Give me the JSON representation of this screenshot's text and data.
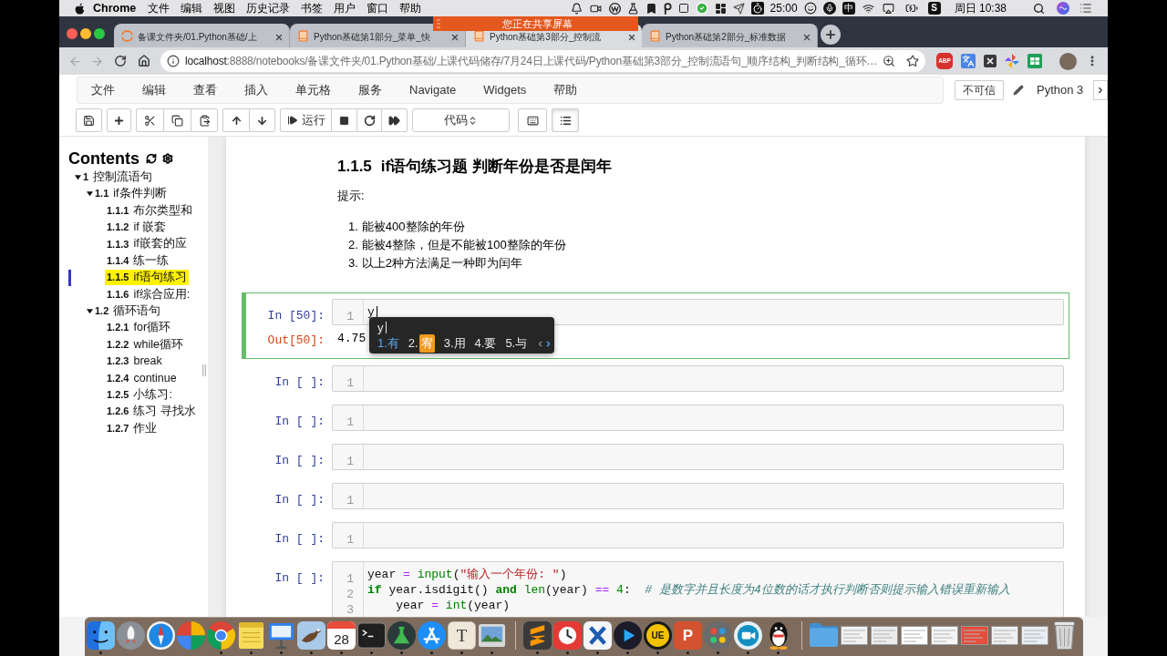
{
  "menu_bar": {
    "app": "Chrome",
    "items": [
      "文件",
      "编辑",
      "视图",
      "历史记录",
      "书签",
      "用户",
      "窗口",
      "帮助"
    ]
  },
  "status": {
    "timer": "25:00",
    "input_source": "中",
    "badge": "S",
    "clock": "周日 10:38"
  },
  "share_banner": "您正在共享屏幕",
  "tabs": [
    {
      "title": "备课文件夹/01.Python基础/上",
      "favicon": {
        "kind": "ring"
      },
      "selected": false
    },
    {
      "title": "Python基础第1部分_菜单_快",
      "favicon": {
        "kind": "book"
      },
      "selected": false
    },
    {
      "title": "Python基础第3部分_控制流",
      "favicon": {
        "kind": "book"
      },
      "selected": true
    },
    {
      "title": "Python基础第2部分_标准数据",
      "favicon": {
        "kind": "book"
      },
      "selected": false
    }
  ],
  "navigation": {
    "back_enabled": false,
    "forward_enabled": false
  },
  "address": {
    "host": "localhost",
    "path": ":8888/notebooks/备课文件夹/01.Python基础/上课代码储存/7月24日上课代码/Python基础第3部分_控制流语句_顺序结构_判断结构_循环…"
  },
  "extensions": [
    {
      "kind": "abp",
      "label": "ABP"
    },
    {
      "kind": "translate"
    },
    {
      "kind": "x"
    },
    {
      "kind": "pinwheel"
    },
    {
      "kind": "sheet"
    },
    {
      "kind": "avatar"
    }
  ],
  "notebook_menu": [
    "文件",
    "编辑",
    "查看",
    "插入",
    "单元格",
    "服务",
    "Navigate",
    "Widgets",
    "帮助"
  ],
  "trust": "不可信",
  "kernel": "Python 3",
  "toolbar": {
    "run": "运行",
    "cell_type": "代码",
    "toc_pressed": true
  },
  "toc": {
    "title": "Contents",
    "items": [
      {
        "number": "1",
        "label": "控制流语句",
        "expanded": true,
        "selected": false,
        "children": [
          {
            "number": "1.1",
            "label": "if条件判断",
            "expanded": true,
            "selected": false,
            "children": [
              {
                "number": "1.1.1",
                "label": "布尔类型和",
                "selected": false
              },
              {
                "number": "1.1.2",
                "label": "if 嵌套",
                "selected": false
              },
              {
                "number": "1.1.3",
                "label": "if嵌套的应",
                "selected": false
              },
              {
                "number": "1.1.4",
                "label": "练一练",
                "selected": false
              },
              {
                "number": "1.1.5",
                "label": "if语句练习",
                "selected": true
              },
              {
                "number": "1.1.6",
                "label": "if综合应用:",
                "selected": false
              }
            ]
          },
          {
            "number": "1.2",
            "label": "循环语句",
            "expanded": true,
            "selected": false,
            "children": [
              {
                "number": "1.2.1",
                "label": "for循环",
                "selected": false
              },
              {
                "number": "1.2.2",
                "label": "while循环",
                "selected": false
              },
              {
                "number": "1.2.3",
                "label": "break",
                "selected": false
              },
              {
                "number": "1.2.4",
                "label": "continue",
                "selected": false
              },
              {
                "number": "1.2.5",
                "label": "小练习:",
                "selected": false
              },
              {
                "number": "1.2.6",
                "label": "练习 寻找水",
                "selected": false
              },
              {
                "number": "1.2.7",
                "label": "作业",
                "selected": false
              }
            ]
          }
        ]
      }
    ]
  },
  "cells": [
    {
      "kind": "markdown",
      "heading": {
        "number": "1.1.5",
        "text": "if语句练习题 判断年份是否是闰年"
      },
      "paragraph": "提示:",
      "list": [
        {
          "marker": "1.",
          "text": "能被400整除的年份"
        },
        {
          "marker": "2.",
          "text": "能被4整除，但是不能被100整除的年份"
        },
        {
          "marker": "3.",
          "text": "以上2种方法满足一种即为闰年"
        }
      ]
    },
    {
      "kind": "code",
      "prompt": "In [50]:",
      "selected": true,
      "lines": [
        {
          "number": "1",
          "tokens": [
            {
              "kind": "name",
              "text": "y"
            }
          ]
        }
      ],
      "output": {
        "prompt": "Out[50]:",
        "text": "4.75"
      },
      "ime_popup": {
        "composition": "y",
        "candidates": [
          {
            "index": "1.",
            "text": "有",
            "selected": true,
            "highlighted": false
          },
          {
            "index": "2.",
            "text": "宥",
            "selected": false,
            "highlighted": true
          },
          {
            "index": "3.",
            "text": "用",
            "selected": false,
            "highlighted": false
          },
          {
            "index": "4.",
            "text": "要",
            "selected": false,
            "highlighted": false
          },
          {
            "index": "5.",
            "text": "与",
            "selected": false,
            "highlighted": false
          }
        ],
        "previous_enabled": false,
        "next_enabled": true
      }
    },
    {
      "kind": "code",
      "prompt": "In [ ]:",
      "selected": false,
      "lines": [
        {
          "number": "1"
        }
      ]
    },
    {
      "kind": "code",
      "prompt": "In [ ]:",
      "selected": false,
      "lines": [
        {
          "number": "1"
        }
      ]
    },
    {
      "kind": "code",
      "prompt": "In [ ]:",
      "selected": false,
      "lines": [
        {
          "number": "1"
        }
      ]
    },
    {
      "kind": "code",
      "prompt": "In [ ]:",
      "selected": false,
      "lines": [
        {
          "number": "1"
        }
      ]
    },
    {
      "kind": "code",
      "prompt": "In [ ]:",
      "selected": false,
      "lines": [
        {
          "number": "1"
        }
      ]
    },
    {
      "kind": "code",
      "prompt": "In [ ]:",
      "selected": false,
      "lines": [
        {
          "number": "1",
          "tokens": [
            {
              "kind": "name",
              "text": "year "
            },
            {
              "kind": "op",
              "text": "= "
            },
            {
              "kind": "builtin",
              "text": "input"
            },
            {
              "kind": "name",
              "text": "("
            },
            {
              "kind": "string",
              "text": "\"输入一个年份: \""
            },
            {
              "kind": "name",
              "text": ")"
            }
          ]
        },
        {
          "number": "2",
          "tokens": [
            {
              "kind": "keyword",
              "text": "if"
            },
            {
              "kind": "name",
              "text": " year.isdigit() "
            },
            {
              "kind": "keyword",
              "text": "and"
            },
            {
              "kind": "builtin",
              "text": " len"
            },
            {
              "kind": "name",
              "text": "(year) "
            },
            {
              "kind": "op",
              "text": "=="
            },
            {
              "kind": "number",
              "text": " 4"
            },
            {
              "kind": "name",
              "text": ":  "
            },
            {
              "kind": "comment",
              "text": "# 是数字并且长度为4位数的话才执行判断否则提示输入错误重新输入"
            }
          ]
        },
        {
          "number": "3",
          "tokens": [
            {
              "kind": "name",
              "text": "    year "
            },
            {
              "kind": "op",
              "text": "= "
            },
            {
              "kind": "builtin",
              "text": "int"
            },
            {
              "kind": "name",
              "text": "(year)"
            }
          ]
        }
      ]
    }
  ],
  "dock": {
    "pinned": [
      {
        "kind": "finder",
        "running": true
      },
      {
        "kind": "launchpad",
        "running": false
      },
      {
        "kind": "safari",
        "running": false
      },
      {
        "kind": "pinwheel",
        "running": false
      },
      {
        "kind": "chrome",
        "running": true
      },
      {
        "kind": "notes",
        "running": true
      },
      {
        "kind": "keynote",
        "running": true
      },
      {
        "kind": "eagle",
        "running": true
      },
      {
        "kind": "calendar",
        "label": "28",
        "running": true
      },
      {
        "kind": "terminal",
        "running": true
      },
      {
        "kind": "flask",
        "running": true
      },
      {
        "kind": "appstore",
        "running": true
      },
      {
        "kind": "letter",
        "label": "T",
        "running": true
      },
      {
        "kind": "preview",
        "running": true
      }
    ],
    "recent": [
      {
        "kind": "sublime",
        "running": true
      },
      {
        "kind": "clock",
        "running": true
      },
      {
        "kind": "cross",
        "running": true
      },
      {
        "kind": "player",
        "running": true
      },
      {
        "kind": "badge",
        "label": "UE",
        "running": true
      },
      {
        "kind": "slides",
        "label": "P",
        "running": true
      },
      {
        "kind": "dots",
        "running": true
      },
      {
        "kind": "video",
        "running": true
      },
      {
        "kind": "penguin",
        "running": true
      }
    ],
    "stacks": [
      {
        "kind": "folder",
        "color": "#5aa9e6"
      },
      {
        "kind": "window",
        "color": "#f2f2f2"
      },
      {
        "kind": "window",
        "color": "#ececec"
      },
      {
        "kind": "window",
        "color": "#ffffff"
      },
      {
        "kind": "window",
        "color": "#f4f4f4"
      },
      {
        "kind": "window",
        "color": "#e74c3c"
      },
      {
        "kind": "window",
        "color": "#f0f0f0"
      },
      {
        "kind": "window",
        "color": "#e8eef5"
      },
      {
        "kind": "trash",
        "color": "#d6d6d6"
      }
    ]
  }
}
